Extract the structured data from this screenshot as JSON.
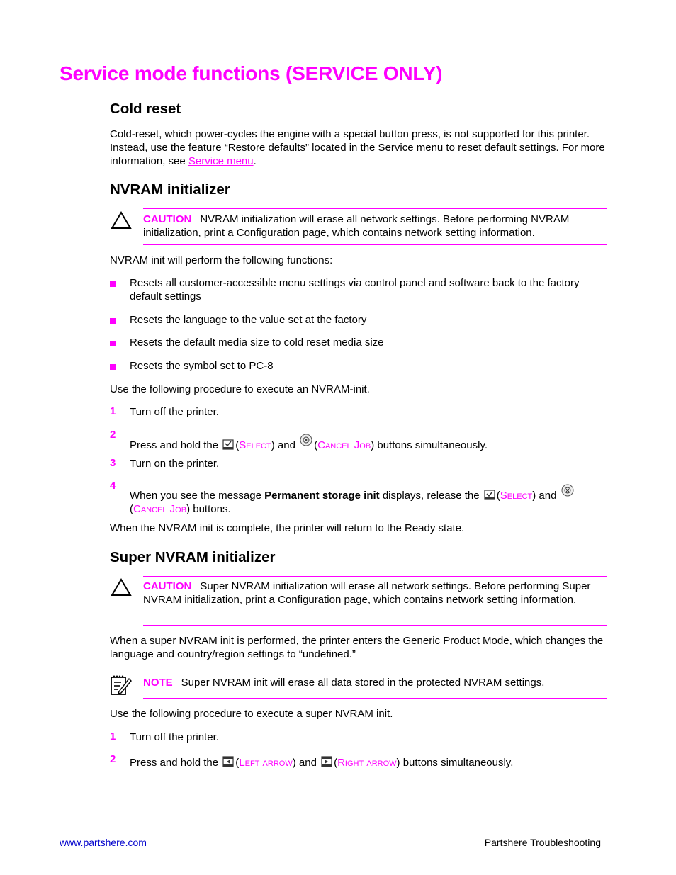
{
  "page": {
    "title": "Service mode functions (SERVICE ONLY)",
    "sections": {
      "cold_reset": {
        "heading": "Cold reset",
        "text_before_link": "Cold-reset, which power-cycles the engine with a special button press, is not supported for this printer. Instead, use the feature “Restore defaults” located in the Service menu to reset default settings. For more information, see ",
        "link": "Service menu",
        "text_after_link": "."
      },
      "nvram": {
        "heading": "NVRAM initializer",
        "caution_label": "CAUTION",
        "caution_text": "NVRAM initialization will erase all network settings. Before performing NVRAM initialization, print a Configuration page, which contains network setting information.",
        "intro": "NVRAM init will perform the following functions:",
        "bullets": [
          "Resets all customer-accessible menu settings via control panel and software back to the factory default settings",
          "Resets the language to the value set at the factory",
          "Resets the default media size to cold reset media size",
          "Resets the symbol set to PC-8"
        ],
        "procedure_intro": "Use the following procedure to execute an NVRAM-init.",
        "steps": [
          {
            "num": "1",
            "text": "Turn off the printer."
          },
          {
            "num": "2",
            "pre": "Press and hold the",
            "btn1": "Select",
            "mid": "and",
            "btn2": "Cancel Job",
            "post": "buttons simultaneously."
          },
          {
            "num": "3",
            "text": "Turn on the printer."
          },
          {
            "num": "4",
            "pre": "When you see the message",
            "bold": "Permanent storage init",
            "pre2": "displays, release the",
            "btn1": "Select",
            "mid": "and",
            "btn2": "Cancel Job",
            "post": "buttons."
          }
        ],
        "complete_text": "When the NVRAM init is complete, the printer will return to the Ready state."
      },
      "super_nvram": {
        "heading": "Super NVRAM initializer",
        "caution_label": "CAUTION",
        "caution_text": "Super NVRAM initialization will erase all network settings. Before performing Super NVRAM initialization, print a Configuration page, which contains network setting information.",
        "description": "When a super NVRAM init is performed, the printer enters the Generic Product Mode, which changes the language and country/region settings to “undefined.”",
        "note_label": "NOTE",
        "note_text": "Super NVRAM init will erase all data stored in the protected NVRAM settings.",
        "procedure_intro": "Use the following procedure to execute a super NVRAM init.",
        "steps": [
          {
            "num": "1",
            "text": "Turn off the printer."
          },
          {
            "num": "2",
            "pre": "Press and hold the",
            "btn1": "Left arrow",
            "mid": "and",
            "btn2": "Right arrow",
            "post": "buttons simultaneously."
          }
        ]
      }
    },
    "footer": {
      "left": "www.partshere.com",
      "right": "Partshere Troubleshooting"
    },
    "colors": {
      "accent": "#ff00ff",
      "footer_link": "#0000cc"
    }
  }
}
